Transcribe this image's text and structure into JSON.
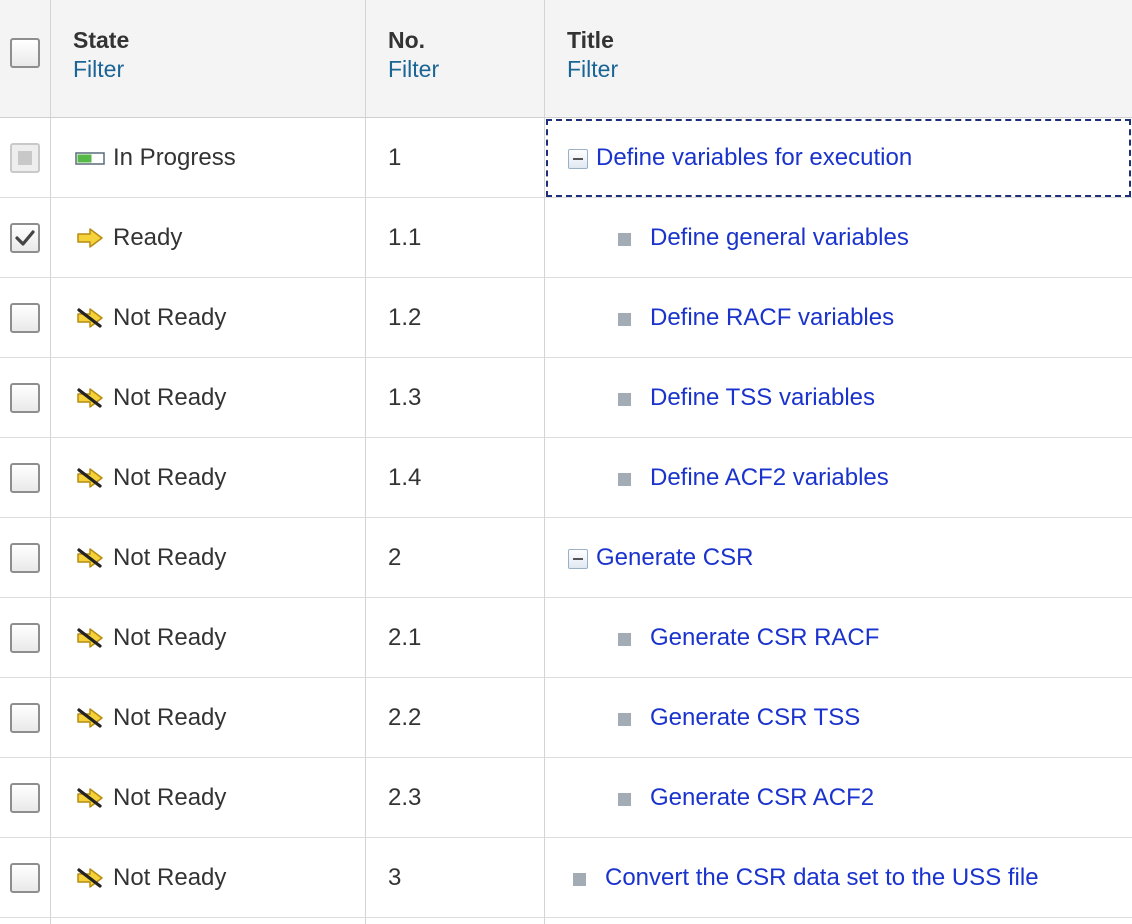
{
  "columns": {
    "state": {
      "title": "State",
      "filter": "Filter"
    },
    "number": {
      "title": "No.",
      "filter": "Filter"
    },
    "title": {
      "title": "Title",
      "filter": "Filter"
    }
  },
  "rows": [
    {
      "checkbox": "disabled",
      "state_icon": "in-progress-icon",
      "state": "In Progress",
      "number": "1",
      "title": "Define variables for execution",
      "node": "collapse",
      "level": 0,
      "focused": true
    },
    {
      "checkbox": "checked",
      "state_icon": "ready-arrow-icon",
      "state": "Ready",
      "number": "1.1",
      "title": "Define general variables",
      "node": "leaf",
      "level": 1,
      "selected": true
    },
    {
      "checkbox": "unchecked",
      "state_icon": "not-ready-icon",
      "state": "Not Ready",
      "number": "1.2",
      "title": "Define RACF variables",
      "node": "leaf",
      "level": 1
    },
    {
      "checkbox": "unchecked",
      "state_icon": "not-ready-icon",
      "state": "Not Ready",
      "number": "1.3",
      "title": "Define TSS variables",
      "node": "leaf",
      "level": 1
    },
    {
      "checkbox": "unchecked",
      "state_icon": "not-ready-icon",
      "state": "Not Ready",
      "number": "1.4",
      "title": "Define ACF2 variables",
      "node": "leaf",
      "level": 1
    },
    {
      "checkbox": "unchecked",
      "state_icon": "not-ready-icon",
      "state": "Not Ready",
      "number": "2",
      "title": "Generate CSR",
      "node": "collapse",
      "level": 0
    },
    {
      "checkbox": "unchecked",
      "state_icon": "not-ready-icon",
      "state": "Not Ready",
      "number": "2.1",
      "title": "Generate CSR RACF",
      "node": "leaf",
      "level": 1
    },
    {
      "checkbox": "unchecked",
      "state_icon": "not-ready-icon",
      "state": "Not Ready",
      "number": "2.2",
      "title": "Generate CSR TSS",
      "node": "leaf",
      "level": 1
    },
    {
      "checkbox": "unchecked",
      "state_icon": "not-ready-icon",
      "state": "Not Ready",
      "number": "2.3",
      "title": "Generate CSR ACF2",
      "node": "leaf",
      "level": 1
    },
    {
      "checkbox": "unchecked",
      "state_icon": "not-ready-icon",
      "state": "Not Ready",
      "number": "3",
      "title": "Convert the CSR data set to the USS file",
      "node": "leaf",
      "level": 0
    }
  ],
  "colors": {
    "link": "#1a33cc",
    "filter_link": "#1a6496",
    "selected_row": "#dff0f7",
    "header_bg": "#f4f4f4"
  }
}
